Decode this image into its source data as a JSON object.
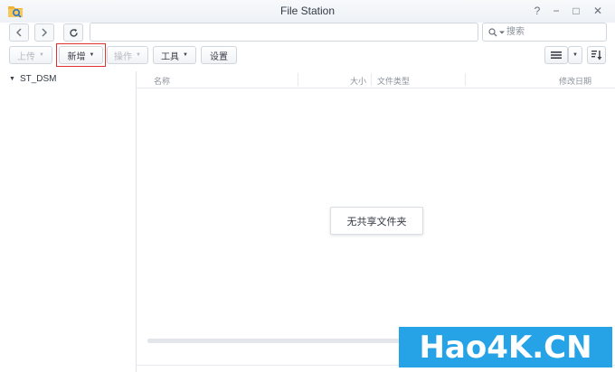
{
  "window": {
    "title": "File Station",
    "controls": {
      "help": "?",
      "minimize": "−",
      "maximize": "□",
      "close": "✕"
    }
  },
  "nav": {
    "back_icon": "chevron-left-icon",
    "forward_icon": "chevron-right-icon",
    "refresh_icon": "refresh-icon",
    "path_value": "",
    "search_placeholder": "搜索"
  },
  "toolbar": {
    "upload_label": "上传",
    "new_label": "新增",
    "action_label": "操作",
    "tools_label": "工具",
    "settings_label": "设置",
    "view_icon": "list-view-icon",
    "sort_icon": "sort-icon"
  },
  "tree": {
    "root_label": "ST_DSM"
  },
  "file_list": {
    "columns": [
      "名称",
      "大小",
      "文件类型",
      "修改日期"
    ],
    "empty_message": "无共享文件夹"
  },
  "watermark": {
    "text": "Hao4K.CN"
  },
  "colors": {
    "accent": "#26a3e6",
    "highlight_border": "#e03131",
    "border": "#cfd6de"
  }
}
